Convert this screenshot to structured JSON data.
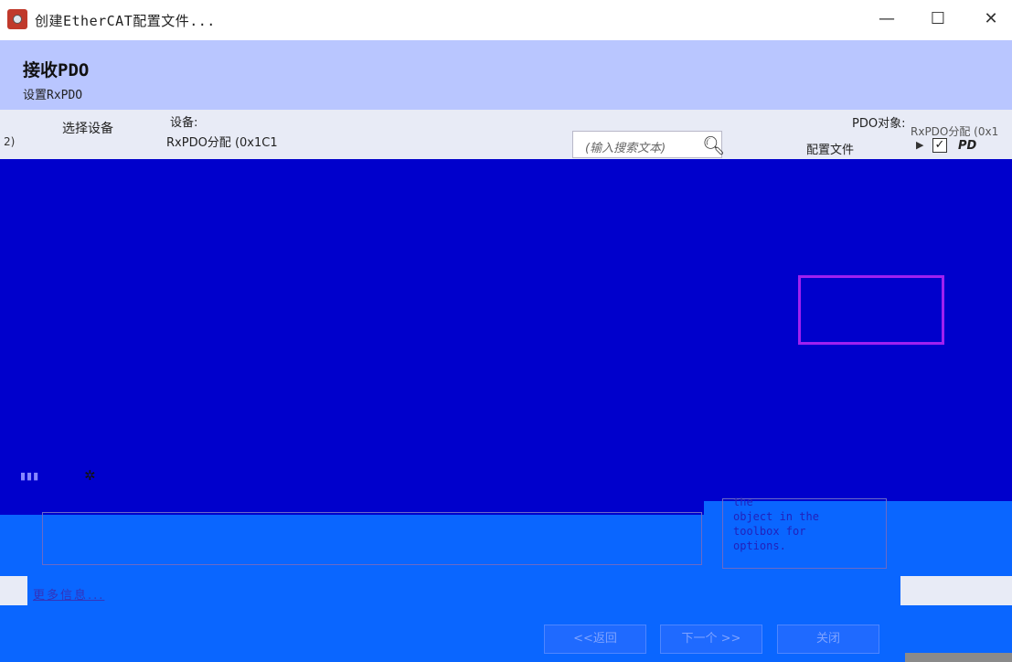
{
  "window": {
    "title": "创建EtherCAT配置文件...",
    "minimize_glyph": "—",
    "maximize_glyph": "☐",
    "close_glyph": "✕"
  },
  "header": {
    "title": "接收PDO",
    "subtitle": "设置RxPDO"
  },
  "nav": {
    "select_device": "选择设备"
  },
  "device": {
    "label": "设备:",
    "value": "RxPDO分配 (0x1C1"
  },
  "pdo_objects": {
    "label": "PDO对象:",
    "overflow_text": "RxPDO分配 (0x1"
  },
  "search": {
    "placeholder": "(输入搜索文本)",
    "icon": "search-icon"
  },
  "columns": {
    "config_file": "配置文件"
  },
  "tree": {
    "item_label": "PD",
    "checked": true
  },
  "hint": {
    "text": "the\nobject in the\ntoolbox for\noptions."
  },
  "links": {
    "more_info": "更多信息..."
  },
  "footer": {
    "back": "<<返回",
    "next": "下一个 >>",
    "close": "关闭"
  },
  "colors": {
    "header_bg": "#b9c6ff",
    "work_area": "#0000cc",
    "lower_pane": "#0a66ff",
    "selection": "#a020f0"
  }
}
